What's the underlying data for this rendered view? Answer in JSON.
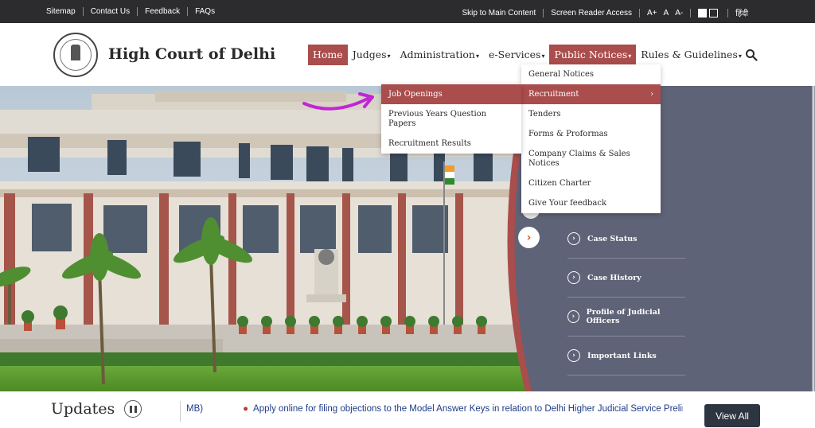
{
  "topbar": {
    "left_links": [
      "Sitemap",
      "Contact Us",
      "Feedback",
      "FAQs"
    ],
    "skip_link": "Skip to Main Content",
    "screen_reader": "Screen Reader Access",
    "font_large": "A+",
    "font_normal": "A",
    "font_small": "A-",
    "language": "हिंदी"
  },
  "header": {
    "title": "High Court of Delhi",
    "nav": {
      "home": "Home",
      "judges": "Judges",
      "administration": "Administration",
      "eservices": "e-Services",
      "public_notices": "Public Notices",
      "rules": "Rules & Guidelines"
    }
  },
  "dropdown": {
    "items": [
      "General Notices",
      "Recruitment",
      "Tenders",
      "Forms & Proformas",
      "Company Claims & Sales Notices",
      "Citizen Charter",
      "Give Your feedback"
    ],
    "highlighted_arrow": "›"
  },
  "submenu": {
    "items": [
      "Job Openings",
      "Previous Years Question Papers",
      "Recruitment Results"
    ]
  },
  "hero_panel": {
    "links": [
      "Case Status",
      "Case History",
      "Profile of Judicial Officers",
      "Important Links"
    ]
  },
  "updates": {
    "title": "Updates",
    "ticker_prefix": "MB)",
    "ticker_text": "Apply online for filing objections to the Model Answer Keys in relation to Delhi Higher Judicial Service Prelimi",
    "view_all": "View All"
  },
  "colors": {
    "accent": "#a94d4d",
    "panel": "#5f6377",
    "topbar": "#2c2c2e",
    "arrow": "#c026d3"
  }
}
